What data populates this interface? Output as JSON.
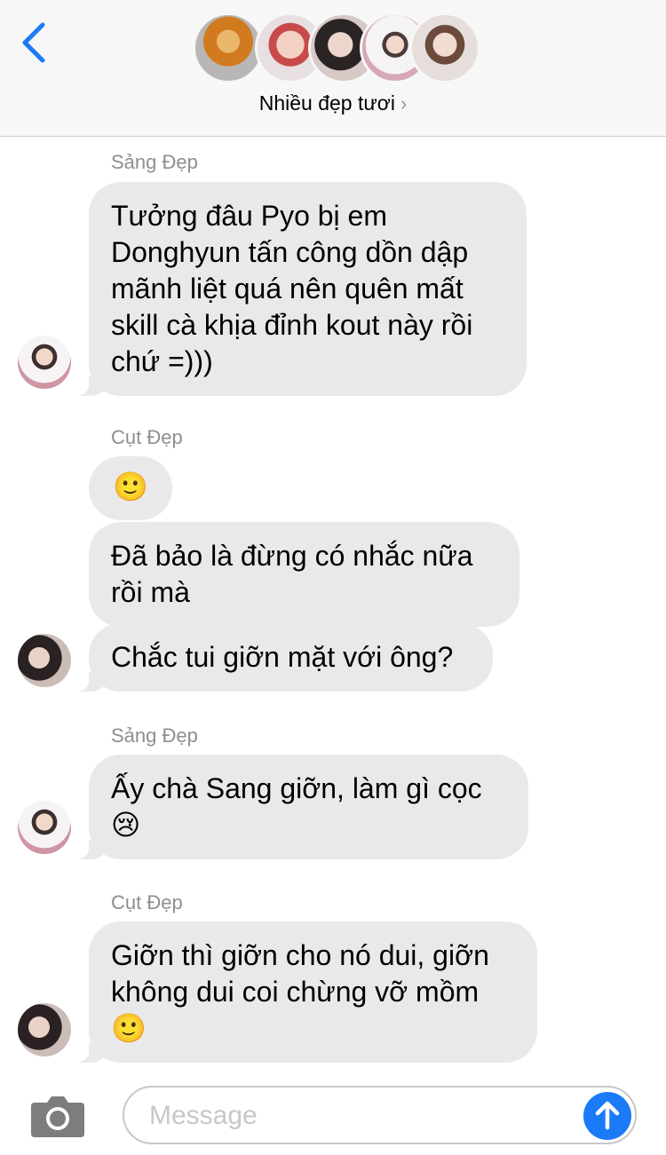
{
  "header": {
    "group_name": "Nhiều đẹp tươi",
    "chevron": "›",
    "back_icon": "chevron-left-icon",
    "avatar_count": 5
  },
  "messages": [
    {
      "sender": "Sảng Đẹp",
      "bubbles": [
        "Tưởng đâu Pyo bị em Donghyun tấn công dồn dập mãnh liệt quá nên quên mất skill cà khịa đỉnh kout này rồi chứ =)))"
      ]
    },
    {
      "sender": "Cụt Đẹp",
      "bubbles": [
        "🙂",
        "Đã bảo là đừng có nhắc nữa rồi mà",
        "Chắc tui giỡn mặt với ông?"
      ]
    },
    {
      "sender": "Sảng Đẹp",
      "bubbles": [
        "Ấy chà Sang giỡn, làm gì cọc 😢"
      ]
    },
    {
      "sender": "Cụt Đẹp",
      "bubbles": [
        "Giỡn thì giỡn cho nó dui, giỡn không dui coi chừng vỡ mồm 🙂"
      ]
    }
  ],
  "composer": {
    "placeholder": "Message",
    "camera_icon": "camera-icon",
    "send_icon": "send-arrow-icon"
  },
  "colors": {
    "accent": "#1b7bf6",
    "bubble": "#e9e9eb",
    "sender_label": "#8e8e93"
  }
}
